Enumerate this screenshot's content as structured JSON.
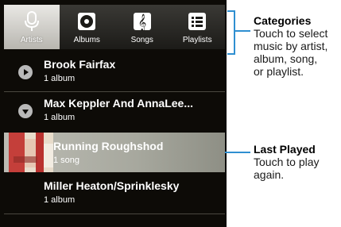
{
  "tabs": [
    {
      "label": "Artists",
      "icon": "microphone-icon",
      "selected": true
    },
    {
      "label": "Albums",
      "icon": "album-disc-icon",
      "selected": false
    },
    {
      "label": "Songs",
      "icon": "music-note-icon",
      "selected": false
    },
    {
      "label": "Playlists",
      "icon": "playlist-icon",
      "selected": false
    }
  ],
  "list": [
    {
      "title": "Brook Fairfax",
      "subtitle": "1 album",
      "expander": "collapsed"
    },
    {
      "title": "Max Keppler And AnnaLee...",
      "subtitle": "1 album",
      "expander": "expanded"
    },
    {
      "title": "Running Roughshod",
      "subtitle": "1 song",
      "highlighted": true
    },
    {
      "title": "Miller Heaton/Sprinklesky",
      "subtitle": "1 album"
    }
  ],
  "callouts": {
    "categories": {
      "title": "Categories",
      "body": "Touch to select\nmusic by artist,\nalbum, song,\nor playlist."
    },
    "last_played": {
      "title": "Last Played",
      "body": "Touch to play\nagain."
    }
  },
  "colors": {
    "accent": "#2f8fd1",
    "background": "#0d0b07",
    "highlight": "#b5b6ac"
  }
}
